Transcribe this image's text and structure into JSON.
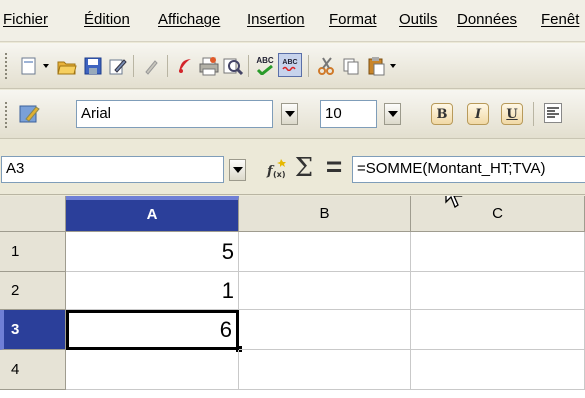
{
  "menu": [
    "Fichier",
    "Édition",
    "Affichage",
    "Insertion",
    "Format",
    "Outils",
    "Données",
    "Fenêt"
  ],
  "toolbar_font": {
    "font_name": "Arial",
    "font_size": "10",
    "bold": "B",
    "italic": "I",
    "underline": "U"
  },
  "toolbar_std": {
    "spellcheck": "ABC",
    "autospell": "ABC"
  },
  "formula_bar": {
    "cell_ref": "A3",
    "sum_symbol": "Σ",
    "equals_symbol": "=",
    "formula": "=SOMME(Montant_HT;TVA)"
  },
  "columns": [
    "A",
    "B",
    "C"
  ],
  "rows": [
    {
      "num": "1",
      "a": "5"
    },
    {
      "num": "2",
      "a": "1"
    },
    {
      "num": "3",
      "a": "6"
    },
    {
      "num": "4",
      "a": ""
    }
  ],
  "selection": {
    "column": "A",
    "row": "3"
  },
  "colors": {
    "selection_header": "#2b3f9a",
    "window_bg": "#ece9d8"
  }
}
